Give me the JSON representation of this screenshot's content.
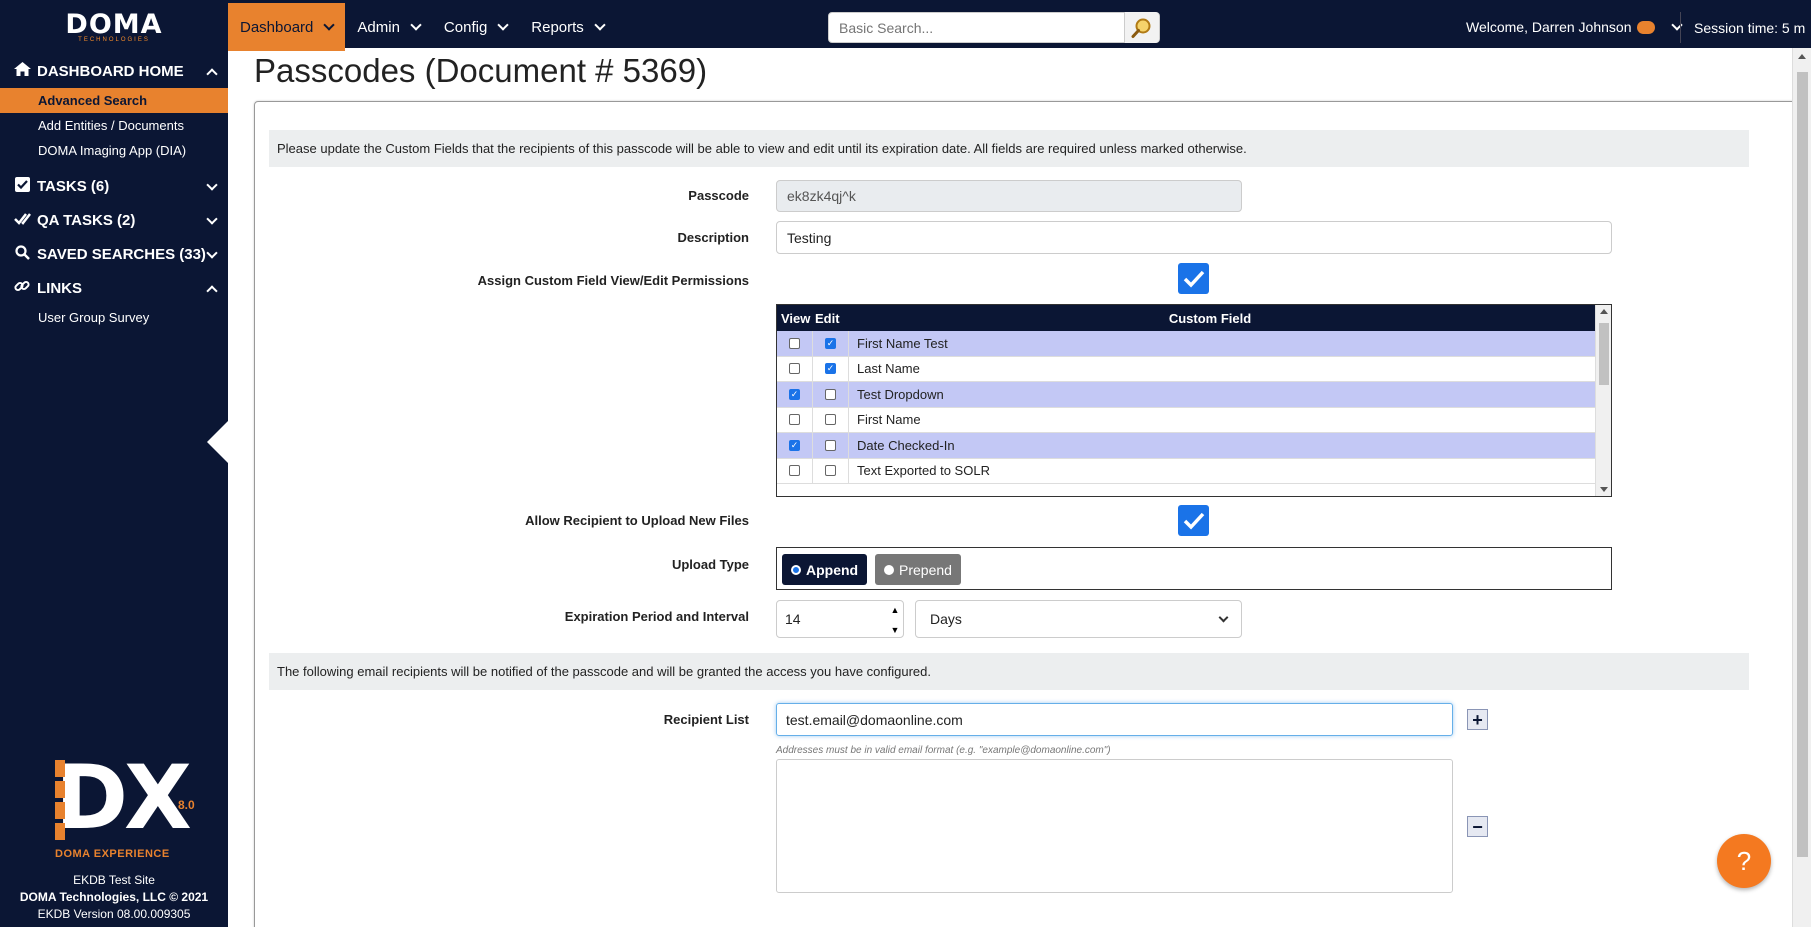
{
  "brand": {
    "name": "DOMA",
    "tagline": "TECHNOLOGIES",
    "accent": "#e8822e",
    "navy": "#0b1634"
  },
  "nav": {
    "items": [
      {
        "label": "Dashboard",
        "active": true
      },
      {
        "label": "Admin",
        "active": false
      },
      {
        "label": "Config",
        "active": false
      },
      {
        "label": "Reports",
        "active": false
      }
    ]
  },
  "search": {
    "placeholder": "Basic Search...",
    "icon": "magnifier-icon"
  },
  "user": {
    "welcome": "Welcome, Darren Johnson",
    "session": "Session time: 5 m"
  },
  "sidebar": {
    "home": "DASHBOARD HOME",
    "home_links": [
      "Advanced Search",
      "Add Entities / Documents",
      "DOMA Imaging App (DIA)"
    ],
    "tasks": "TASKS (6)",
    "qa_tasks": "QA TASKS (2)",
    "saved_searches": "SAVED SEARCHES (33)",
    "links": "LINKS",
    "links_items": [
      "User Group Survey"
    ],
    "dx": {
      "letters": "DX",
      "version": "8.0",
      "subtitle": "DOMA EXPERIENCE"
    },
    "footer": {
      "site": "EKDB Test Site",
      "copyright": "DOMA Technologies, LLC © 2021",
      "version": "EKDB Version 08.00.009305"
    }
  },
  "page": {
    "title": "Passcodes (Document # 5369)"
  },
  "form": {
    "intro": "Please update the Custom Fields that the recipients of this passcode will be able to view and edit until its expiration date. All fields are required unless marked otherwise.",
    "passcode_label": "Passcode",
    "passcode_value": "ek8zk4qj^k",
    "description_label": "Description",
    "description_value": "Testing",
    "assign_label": "Assign Custom Field View/Edit Permissions",
    "assign_checked": true,
    "grid": {
      "headers": {
        "view": "View",
        "edit": "Edit",
        "field": "Custom Field"
      },
      "rows": [
        {
          "view": false,
          "edit": true,
          "field": "First Name Test"
        },
        {
          "view": false,
          "edit": true,
          "field": "Last Name"
        },
        {
          "view": true,
          "edit": false,
          "field": "Test Dropdown"
        },
        {
          "view": false,
          "edit": false,
          "field": "First Name"
        },
        {
          "view": true,
          "edit": false,
          "field": "Date Checked-In"
        },
        {
          "view": false,
          "edit": false,
          "field": "Text Exported to SOLR"
        }
      ]
    },
    "upload_label": "Allow Recipient to Upload New Files",
    "upload_checked": true,
    "upload_type_label": "Upload Type",
    "upload_types": {
      "append": "Append",
      "prepend": "Prepend",
      "selected": "Append"
    },
    "expiration_label": "Expiration Period and Interval",
    "expiration_value": "14",
    "interval_value": "Days",
    "recipients_intro": "The following email recipients will be notified of the passcode and will be granted the access you have configured.",
    "recipient_label": "Recipient List",
    "recipient_value": "test.email@domaonline.com",
    "recipient_hint": "Addresses must be in valid email format (e.g. \"example@domaonline.com\")",
    "add": "+",
    "remove": "−"
  },
  "help": "?"
}
